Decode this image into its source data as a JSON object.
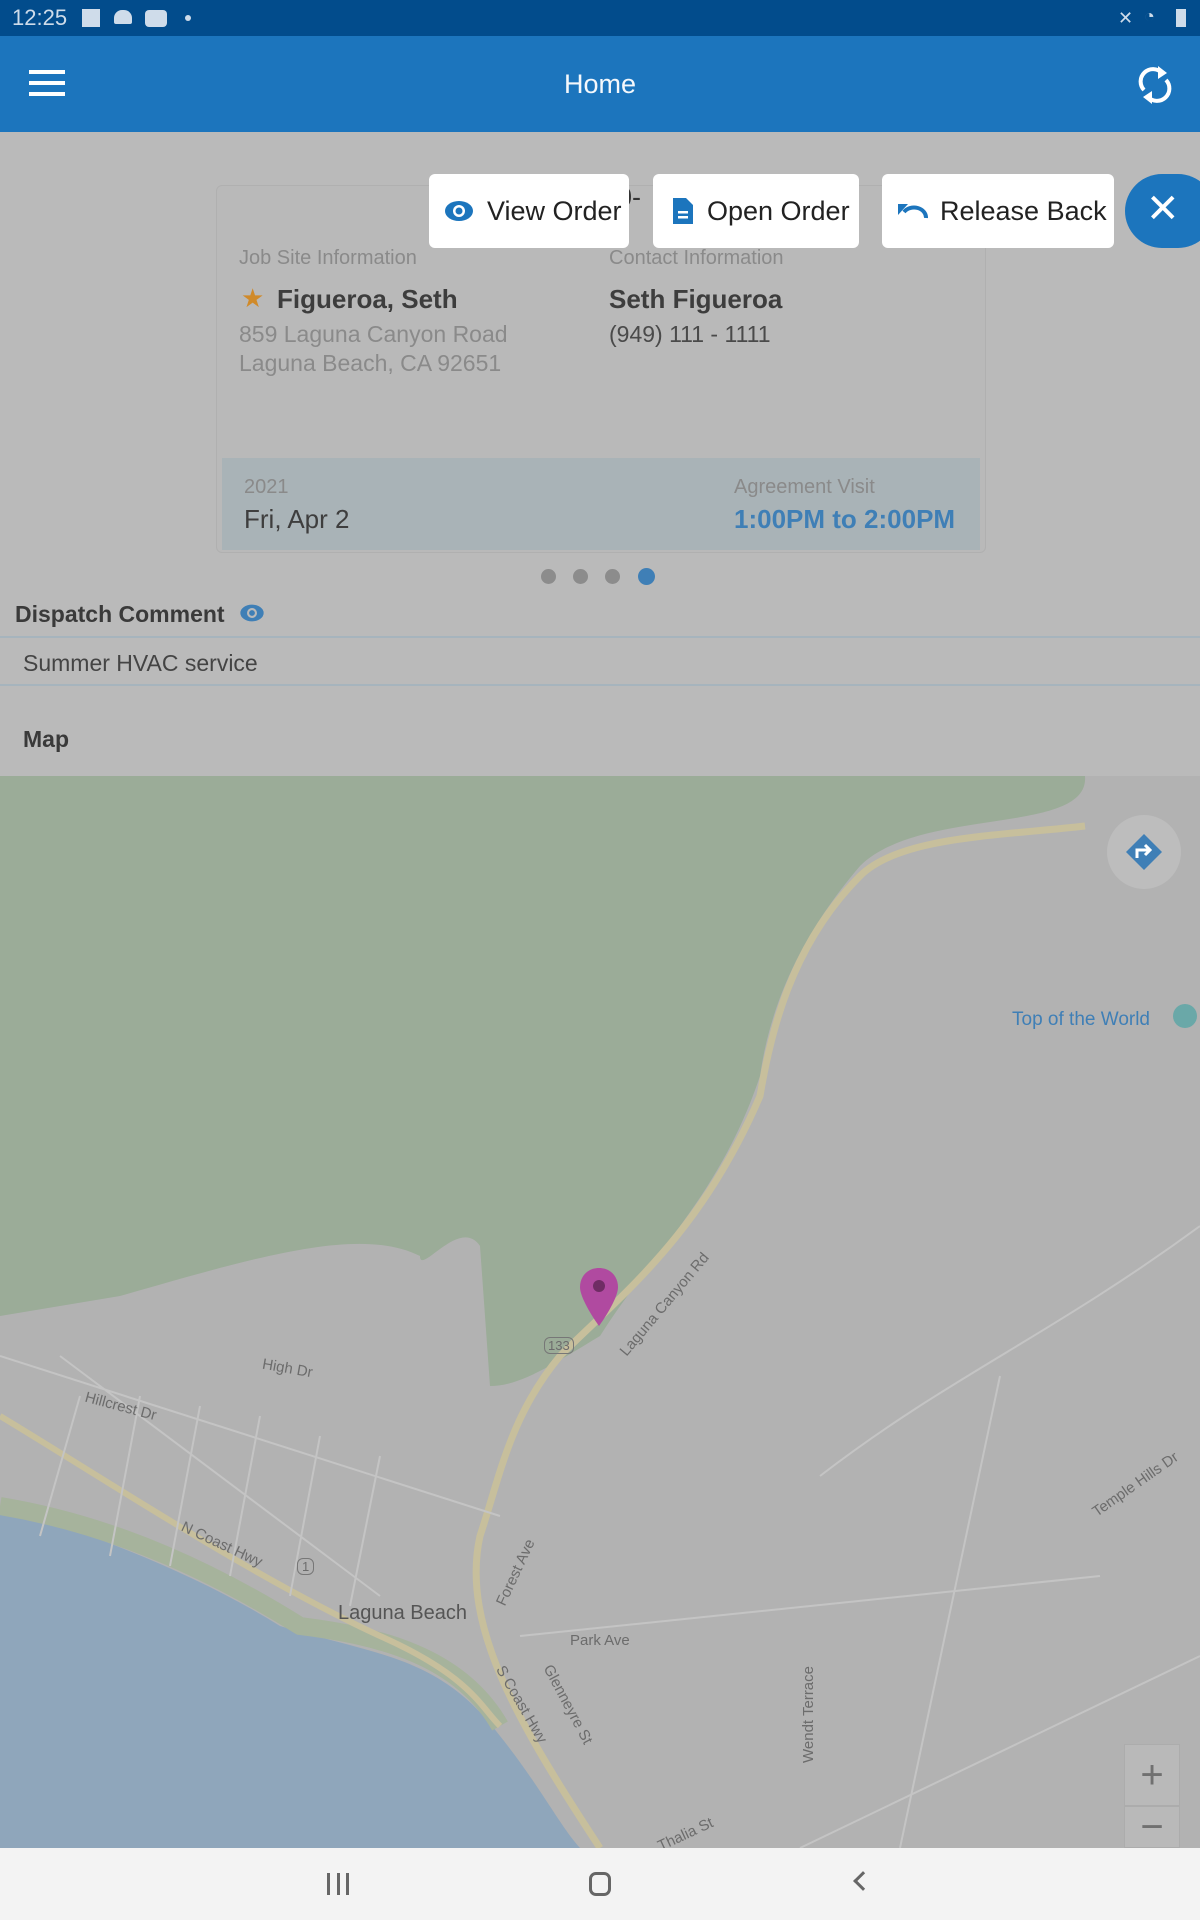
{
  "status_bar": {
    "time": "12:25"
  },
  "app_bar": {
    "title": "Home",
    "menu_icon": "hamburger-icon",
    "sync_icon": "sync-icon"
  },
  "actions": {
    "view_order": "View Order",
    "open_order": "Open Order",
    "release_back": "Release Back",
    "hidden_fragment": "0-"
  },
  "card": {
    "job_site_label": "Job Site Information",
    "job_site_name": "Figueroa, Seth",
    "address_line1": "859 Laguna Canyon Road",
    "address_line2": "Laguna Beach, CA 92651",
    "contact_label": "Contact Information",
    "contact_name": "Seth Figueroa",
    "contact_phone": "(949) 111 - 1111",
    "year": "2021",
    "date": "Fri, Apr 2",
    "visit_type": "Agreement Visit",
    "time_range": "1:00PM to 2:00PM"
  },
  "pager": {
    "count": 4,
    "active": 4
  },
  "dispatch": {
    "label": "Dispatch Comment",
    "value": "Summer HVAC service"
  },
  "map": {
    "label": "Map",
    "labels": {
      "top": "Top of the World",
      "canyon": "Laguna Canyon Rd",
      "high": "High Dr",
      "hillcrest": "Hillcrest Dr",
      "ncoast": "N Coast Hwy",
      "laguna": "Laguna Beach",
      "forest": "Forest Ave",
      "park": "Park Ave",
      "scoast": "S Coast Hwy",
      "glenneyre": "Glenneyre St",
      "wendt": "Wendt Terrace",
      "temple": "Temple Hills Dr",
      "thalia": "Thalia St",
      "r133": "133",
      "r1": "1"
    },
    "zoom_in": "+",
    "zoom_out": "−"
  },
  "colors": {
    "primary": "#1c75bd",
    "status": "#024c8c",
    "accent_time": "#3f7fb6",
    "star": "#d08a2a",
    "pin": "#b04aa0"
  }
}
